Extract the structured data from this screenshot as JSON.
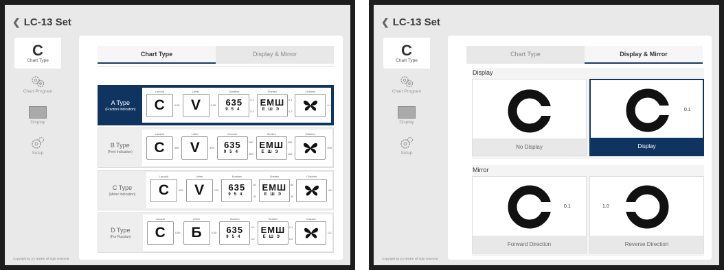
{
  "app_title": "LC-13 Set",
  "sidebar": {
    "items": [
      {
        "label": "Chart Type",
        "icon": "landolt-c-icon"
      },
      {
        "label": "Chart Program",
        "icon": "gears-icon"
      },
      {
        "label": "Display",
        "icon": "display-icon"
      },
      {
        "label": "Setup",
        "icon": "gear-icon"
      }
    ]
  },
  "copyright": "Copyright by (c) NIDEK all right reserved",
  "tabs": {
    "chart_type": "Chart Type",
    "display_mirror": "Display & Mirror"
  },
  "chart_types": {
    "col_landolt": "Landolt",
    "col_letter": "Letter",
    "col_number": "Number",
    "col_snellen": "Snellen",
    "col_children": "Children",
    "rows": [
      {
        "title": "A Type",
        "sub": "(Fraction Indication)",
        "letter": "V",
        "v_landolt": "0.05",
        "v_letter": "0.05",
        "v_num_top": "0.1",
        "v_num_bot": "0.2",
        "v_sn_top": "0.1",
        "v_sn_bot": "0.2",
        "v_child": "0.1"
      },
      {
        "title": "B Type",
        "sub": "(Feet Indication)",
        "letter": "V",
        "v_landolt": "400",
        "v_letter": "400",
        "v_num_top": "200",
        "v_num_bot": "100",
        "v_sn_top": "200",
        "v_sn_bot": "100",
        "v_child": "200"
      },
      {
        "title": "C Type",
        "sub": "(Meter Indication)",
        "letter": "V",
        "v_landolt": "120",
        "v_letter": "120",
        "v_num_top": "60",
        "v_num_bot": "30",
        "v_sn_top": "60",
        "v_sn_bot": "30",
        "v_child": "60"
      },
      {
        "title": "D Type",
        "sub": "(For Russian)",
        "letter": "Б",
        "v_landolt": "0.05",
        "v_letter": "0.05",
        "v_num_top": "0.1",
        "v_num_bot": "0.2",
        "v_sn_top": "0.1",
        "v_sn_bot": "0.2",
        "v_child": "0.1"
      }
    ],
    "landolt_glyph": "C",
    "number_line1": "635",
    "number_line2": "954",
    "snellen_line1": "EMШ",
    "snellen_line2": "EШЭ"
  },
  "display_mirror": {
    "display_label": "Display",
    "mirror_label": "Mirror",
    "value": "0.1",
    "value_reversed": "1.0",
    "display_cards": [
      {
        "label": "No Display",
        "selected": false
      },
      {
        "label": "Display",
        "selected": true
      }
    ],
    "mirror_cards": [
      {
        "label": "Forward Direction",
        "selected": false
      },
      {
        "label": "Reverse Direction",
        "selected": false
      }
    ]
  },
  "colors": {
    "accent": "#0f3460",
    "background": "#e9e9e9"
  }
}
